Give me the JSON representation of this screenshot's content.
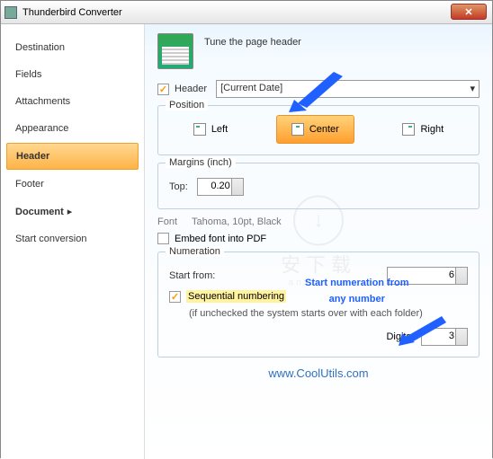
{
  "window": {
    "title": "Thunderbird Converter"
  },
  "sidebar": {
    "items": [
      {
        "label": "Destination"
      },
      {
        "label": "Fields"
      },
      {
        "label": "Attachments"
      },
      {
        "label": "Appearance"
      },
      {
        "label": "Header"
      },
      {
        "label": "Footer"
      },
      {
        "label": "Document"
      },
      {
        "label": "Start conversion"
      }
    ],
    "active_index": 4,
    "submenu_chevron": "▸"
  },
  "header_section": {
    "tune_label": "Tune the page header",
    "header_checkbox_label": "Header",
    "header_checked": true,
    "header_value": "[Current Date]"
  },
  "position": {
    "legend": "Position",
    "left": "Left",
    "center": "Center",
    "right": "Right",
    "selected": "center"
  },
  "margins": {
    "legend": "Margins (inch)",
    "top_label": "Top:",
    "top_value": "0.20"
  },
  "font": {
    "label": "Font",
    "value": "Tahoma, 10pt, Black",
    "embed_label": "Embed font into PDF",
    "embed_checked": false
  },
  "numeration": {
    "legend": "Numeration",
    "start_label": "Start from:",
    "start_value": "6",
    "sequential_label": "Sequential numbering",
    "sequential_checked": true,
    "note": "(if unchecked the system starts over with each folder)",
    "digits_label": "Digits:",
    "digits_value": "3"
  },
  "callout": {
    "line1": "Start numeration from",
    "line2": "any number"
  },
  "footer_link": "www.CoolUtils.com",
  "watermark": {
    "big": "安下载",
    "small": "anxz.com"
  }
}
